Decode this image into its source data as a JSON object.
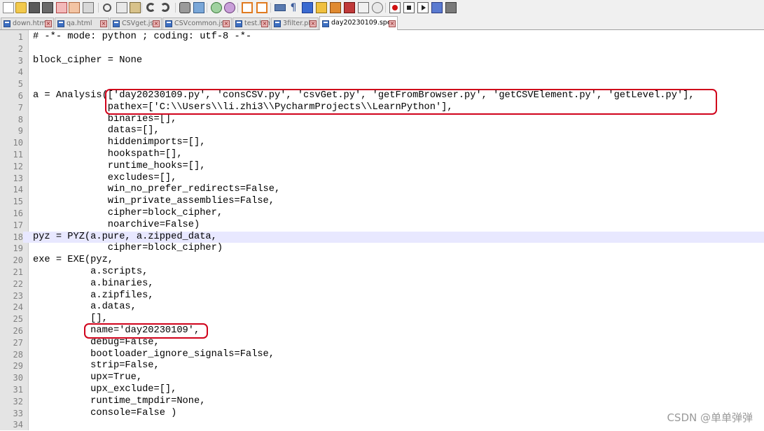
{
  "toolbar": {
    "icons": [
      "new-file-icon",
      "open-file-icon",
      "save-icon",
      "save-all-icon",
      "close-icon",
      "close-all-icon",
      "print-icon",
      "cut-icon",
      "copy-icon",
      "paste-icon",
      "undo-icon",
      "redo-icon",
      "find-icon",
      "replace-icon",
      "zoom-in-icon",
      "zoom-out-icon",
      "sync-vertical-icon",
      "sync-horizontal-icon",
      "word-wrap-icon",
      "show-all-chars-icon",
      "indent-guide-icon",
      "language-icon",
      "doc-map-icon",
      "function-list-icon",
      "folder-workspace-icon",
      "monitor-icon",
      "record-macro-icon",
      "stop-macro-icon",
      "play-macro-icon",
      "run-macro-multiple-icon",
      "save-macro-icon"
    ]
  },
  "tabs": [
    {
      "label": "down.html",
      "active": false
    },
    {
      "label": "qa.html",
      "active": false
    },
    {
      "label": "CSVget.js",
      "active": false
    },
    {
      "label": "CSVcommon.js",
      "active": false
    },
    {
      "label": "test.html",
      "active": false
    },
    {
      "label": "3filter.pl",
      "active": false
    },
    {
      "label": "day20230109.spec",
      "active": true
    }
  ],
  "editor": {
    "current_line": 18,
    "lines": [
      {
        "n": "1",
        "t": "# -*- mode: python ; coding: utf-8 -*-"
      },
      {
        "n": "2",
        "t": ""
      },
      {
        "n": "3",
        "t": "block_cipher = None"
      },
      {
        "n": "4",
        "t": ""
      },
      {
        "n": "5",
        "t": ""
      },
      {
        "n": "6",
        "t": "a = Analysis(['day20230109.py', 'consCSV.py', 'csvGet.py', 'getFromBrowser.py', 'getCSVElement.py', 'getLevel.py'],"
      },
      {
        "n": "7",
        "t": "             pathex=['C:\\\\Users\\\\li.zhi3\\\\PycharmProjects\\\\LearnPython'],"
      },
      {
        "n": "8",
        "t": "             binaries=[],"
      },
      {
        "n": "9",
        "t": "             datas=[],"
      },
      {
        "n": "10",
        "t": "             hiddenimports=[],"
      },
      {
        "n": "11",
        "t": "             hookspath=[],"
      },
      {
        "n": "12",
        "t": "             runtime_hooks=[],"
      },
      {
        "n": "13",
        "t": "             excludes=[],"
      },
      {
        "n": "14",
        "t": "             win_no_prefer_redirects=False,"
      },
      {
        "n": "15",
        "t": "             win_private_assemblies=False,"
      },
      {
        "n": "16",
        "t": "             cipher=block_cipher,"
      },
      {
        "n": "17",
        "t": "             noarchive=False)"
      },
      {
        "n": "18",
        "t": "pyz = PYZ(a.pure, a.zipped_data,"
      },
      {
        "n": "19",
        "t": "             cipher=block_cipher)"
      },
      {
        "n": "20",
        "t": "exe = EXE(pyz,"
      },
      {
        "n": "21",
        "t": "          a.scripts,"
      },
      {
        "n": "22",
        "t": "          a.binaries,"
      },
      {
        "n": "23",
        "t": "          a.zipfiles,"
      },
      {
        "n": "24",
        "t": "          a.datas,"
      },
      {
        "n": "25",
        "t": "          [],"
      },
      {
        "n": "26",
        "t": "          name='day20230109',"
      },
      {
        "n": "27",
        "t": "          debug=False,"
      },
      {
        "n": "28",
        "t": "          bootloader_ignore_signals=False,"
      },
      {
        "n": "29",
        "t": "          strip=False,"
      },
      {
        "n": "30",
        "t": "          upx=True,"
      },
      {
        "n": "31",
        "t": "          upx_exclude=[],"
      },
      {
        "n": "32",
        "t": "          runtime_tmpdir=None,"
      },
      {
        "n": "33",
        "t": "          console=False )"
      },
      {
        "n": "34",
        "t": ""
      }
    ]
  },
  "watermark": "CSDN @单单弹弹",
  "colors": {
    "highlight_box": "#d0021b",
    "current_line": "#e8e8ff",
    "gutter": "#e4e4e4"
  }
}
